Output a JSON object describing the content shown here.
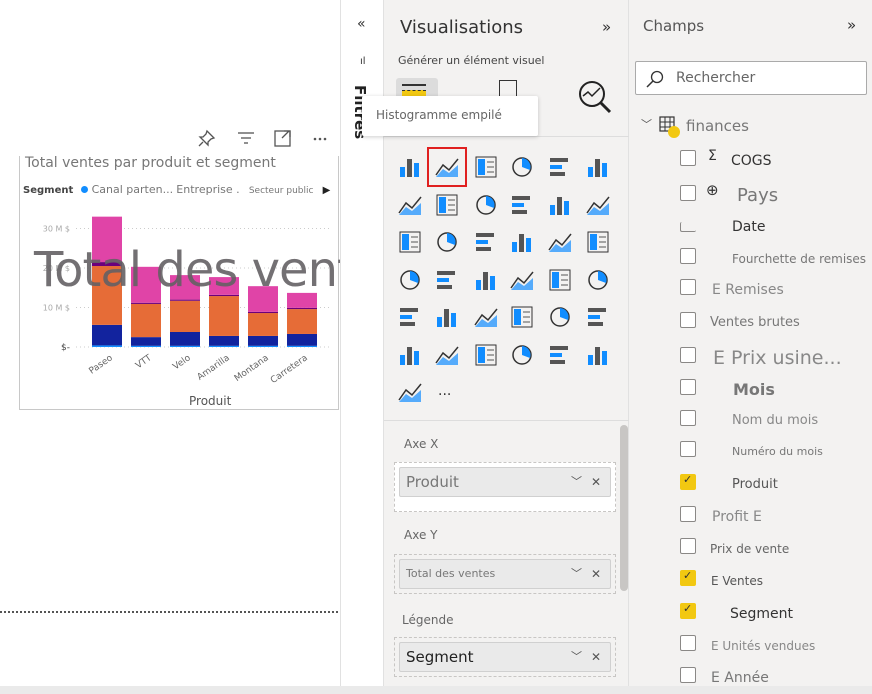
{
  "visual": {
    "toolbar_icons": [
      "pin-icon",
      "filter-icon",
      "focus-mode-icon",
      "more-options-icon"
    ],
    "title": "Total ventes par produit et segment",
    "legend_title": "Segment",
    "legend_items": [
      "Canal parten...",
      "Entreprise .",
      "Secteur public"
    ],
    "overlay_text": "Total des ventes",
    "x_axis_title": "Produit"
  },
  "chart_data": {
    "type": "bar",
    "stacked": true,
    "title": "Total ventes par produit et segment",
    "xlabel": "Produit",
    "ylabel": "",
    "categories": [
      "Paseo",
      "VTT",
      "Velo",
      "Amarilla",
      "Montana",
      "Carretera"
    ],
    "y_ticks": [
      "$-",
      "10 M $",
      "20 M $",
      "30 M $"
    ],
    "ylim": [
      0,
      33
    ],
    "grid": true,
    "legend_placement": "top",
    "series": [
      {
        "color": "#118dff",
        "values": [
          0.4,
          0.3,
          0.3,
          0.3,
          0.3,
          0.3
        ]
      },
      {
        "color": "#12239e",
        "values": [
          5.2,
          2.2,
          3.5,
          2.5,
          2.5,
          3.0
        ]
      },
      {
        "color": "#e66c37",
        "values": [
          14.9,
          8.4,
          7.9,
          10.1,
          5.8,
          6.3
        ]
      },
      {
        "color": "#6b007b",
        "values": [
          1.0,
          0.3,
          0.3,
          0.3,
          0.3,
          0.3
        ]
      },
      {
        "color": "#e044a7",
        "values": [
          11.5,
          9.1,
          6.2,
          4.5,
          6.5,
          3.8
        ]
      }
    ]
  },
  "filters": {
    "collapse_icon": "double-chevron-left-icon",
    "label": "Filtres"
  },
  "visualizations": {
    "title": "Visualisations",
    "subtitle": "Générer un élément visuel",
    "tooltip": "Histogramme empilé",
    "more": "...",
    "selected_index": 1,
    "icons": [
      "stacked-bar-icon",
      "stacked-column-icon",
      "clustered-bar-icon",
      "clustered-column-icon",
      "100-stacked-bar-icon",
      "100-stacked-column-icon",
      "line-icon",
      "area-icon",
      "stacked-area-icon",
      "line-column-icon",
      "line-clustered-column-icon",
      "ribbon-icon",
      "waterfall-icon",
      "funnel-icon",
      "scatter-icon",
      "pie-icon",
      "donut-icon",
      "treemap-icon",
      "map-icon",
      "filled-map-icon",
      "azure-map-icon",
      "gauge-icon",
      "card-icon",
      "multi-row-card-icon",
      "kpi-icon",
      "slicer-icon",
      "table-icon",
      "matrix-icon",
      "decomposition-tree-icon",
      "key-influencers-icon",
      "qa-icon",
      "smart-narrative-icon",
      "trophy-icon",
      "paginated-report-icon",
      "power-apps-icon",
      "power-automate-icon",
      "power-automate-flow-icon"
    ],
    "wells": [
      {
        "label": "Axe X",
        "value": "Produit"
      },
      {
        "label": "Axe Y",
        "value": "Total des ventes"
      },
      {
        "label": "Légende",
        "value": "Segment"
      }
    ]
  },
  "fields": {
    "title": "Champs",
    "search_placeholder": "Rechercher",
    "table": "finances",
    "items": [
      {
        "label": "COGS",
        "checked": false,
        "prefix": "Σ"
      },
      {
        "label": "Pays",
        "checked": false
      },
      {
        "label": "Date",
        "checked": false
      },
      {
        "label": "Fourchette de remises",
        "checked": false
      },
      {
        "label": "E Remises",
        "checked": false
      },
      {
        "label": "Ventes brutes",
        "checked": false
      },
      {
        "label": "E Prix usine...",
        "checked": false
      },
      {
        "label": "Mois",
        "checked": false
      },
      {
        "label": "Nom du mois",
        "checked": false
      },
      {
        "label": "Numéro du mois",
        "checked": false
      },
      {
        "label": "Produit",
        "checked": true
      },
      {
        "label": "Profit E",
        "checked": false
      },
      {
        "label": "Prix de vente",
        "checked": false
      },
      {
        "label": "E Ventes",
        "checked": true
      },
      {
        "label": "Segment",
        "checked": true
      },
      {
        "label": "E Unités vendues",
        "checked": false
      },
      {
        "label": "E Année",
        "checked": false
      }
    ]
  }
}
